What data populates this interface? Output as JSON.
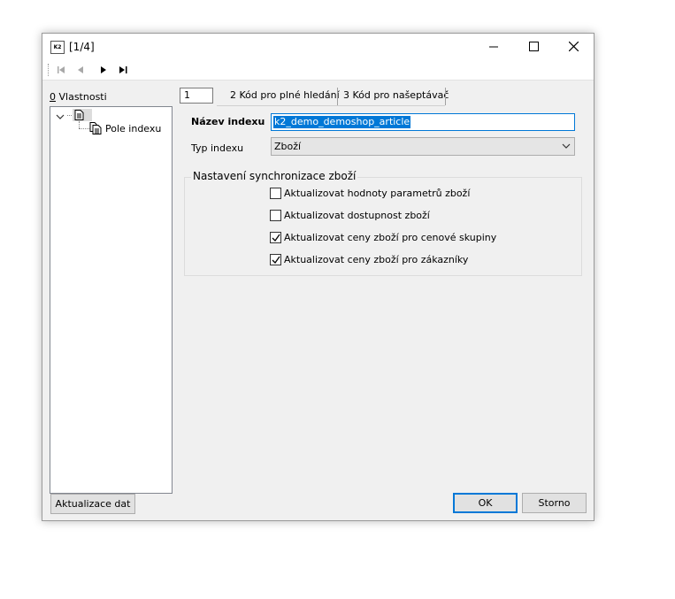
{
  "window": {
    "app_icon_text": "K2",
    "title": "[1/4]",
    "controls": {
      "minimize": "minimize-icon",
      "maximize": "maximize-icon",
      "close": "close-icon"
    }
  },
  "toolbar": {
    "icons": [
      "first-record-icon",
      "previous-record-icon",
      "next-record-icon",
      "last-record-icon"
    ]
  },
  "left_panel": {
    "label_underlined": "0",
    "label_rest": " Vlastnosti",
    "tree": {
      "root": {
        "icon": "document-icon",
        "expanded": true
      },
      "children": [
        {
          "label": "Pole indexu",
          "icon": "documents-icon"
        }
      ]
    }
  },
  "tabs": {
    "current_value": "1",
    "items": [
      {
        "label": "2 Kód pro plné hledání"
      },
      {
        "label": "3 Kód pro našeptávač"
      }
    ]
  },
  "form": {
    "name_label": "Název indexu",
    "name_value": "k2_demo_demoshop_article",
    "type_label": "Typ indexu",
    "type_value": "Zboží"
  },
  "sync_group": {
    "title": "Nastavení synchronizace zboží",
    "options": [
      {
        "label": "Aktualizovat hodnoty parametrů zboží",
        "checked": false
      },
      {
        "label": "Aktualizovat dostupnost zboží",
        "checked": false
      },
      {
        "label": "Aktualizovat ceny zboží pro cenové skupiny",
        "checked": true
      },
      {
        "label": "Aktualizovat ceny zboží pro zákazníky",
        "checked": true
      }
    ]
  },
  "buttons": {
    "refresh": "Aktualizace dat",
    "ok": "OK",
    "cancel": "Storno"
  },
  "colors": {
    "accent": "#0078d7",
    "window_bg": "#f0f0f0",
    "titlebar_bg": "#ffffff"
  }
}
